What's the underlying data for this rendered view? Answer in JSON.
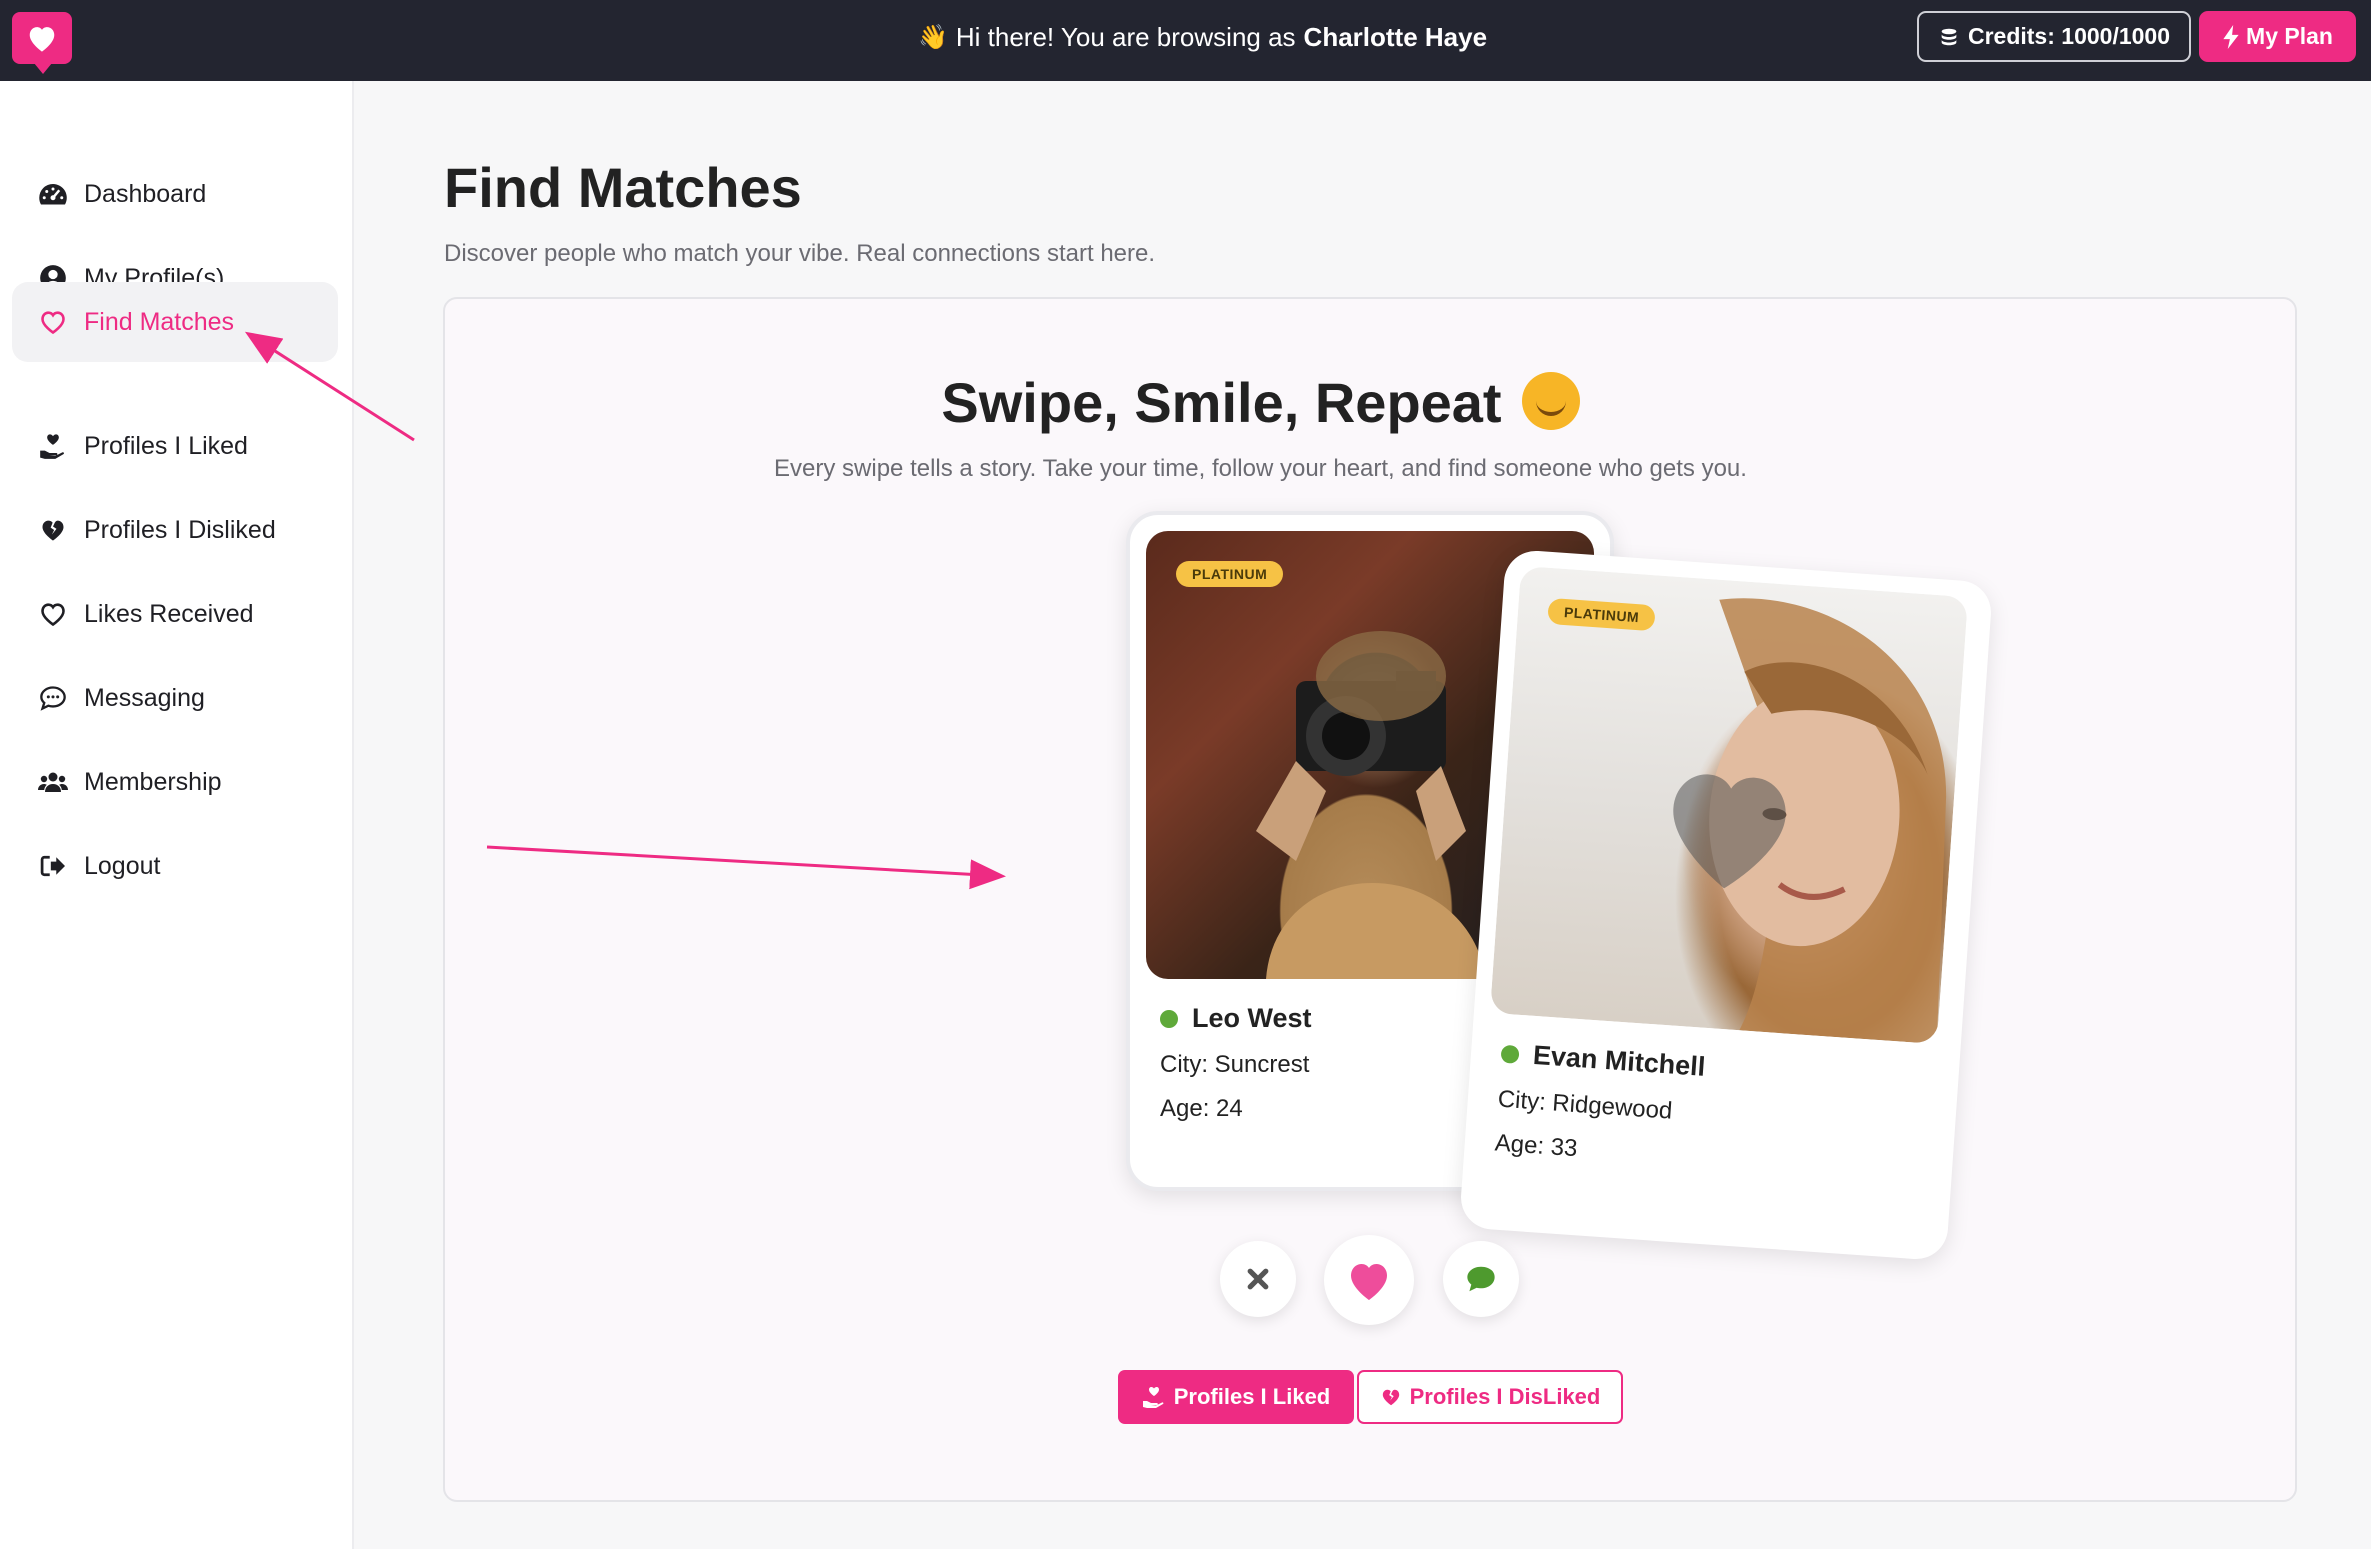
{
  "topbar": {
    "greeting_prefix": "Hi there! You are browsing as",
    "user_name": "Charlotte Haye",
    "credits_label": "Credits: 1000/1000",
    "plan_label": "My Plan"
  },
  "sidebar": {
    "items": [
      {
        "label": "Dashboard",
        "icon": "gauge-icon"
      },
      {
        "label": "My Profile(s)",
        "icon": "user-circle-icon"
      },
      {
        "label": "Find Matches",
        "icon": "heart-outline-icon",
        "active": true
      },
      {
        "label": "Profiles I Liked",
        "icon": "hand-heart-icon"
      },
      {
        "label": "Profiles I Disliked",
        "icon": "broken-heart-icon"
      },
      {
        "label": "Likes Received",
        "icon": "heart-outline-icon"
      },
      {
        "label": "Messaging",
        "icon": "chat-bubble-icon"
      },
      {
        "label": "Membership",
        "icon": "users-icon"
      },
      {
        "label": "Logout",
        "icon": "logout-icon"
      }
    ]
  },
  "main": {
    "title": "Find Matches",
    "subtitle": "Discover people who match your vibe. Real connections start here.",
    "panel_title": "Swipe, Smile, Repeat",
    "panel_subtitle": "Every swipe tells a story. Take your time, follow your heart, and find someone who gets you."
  },
  "cards": [
    {
      "badge": "PLATINUM",
      "name": "Leo West",
      "city": "City: Suncrest",
      "age": "Age: 24"
    },
    {
      "badge": "PLATINUM",
      "name": "Evan Mitchell",
      "city": "City: Ridgewood",
      "age": "Age: 33"
    }
  ],
  "actions": {
    "liked_button": "Profiles I Liked",
    "disliked_button": "Profiles I DisLiked"
  },
  "colors": {
    "brand": "#ee2b83",
    "topbar": "#232530",
    "online": "#5fa93a",
    "badge": "#f6c245"
  }
}
